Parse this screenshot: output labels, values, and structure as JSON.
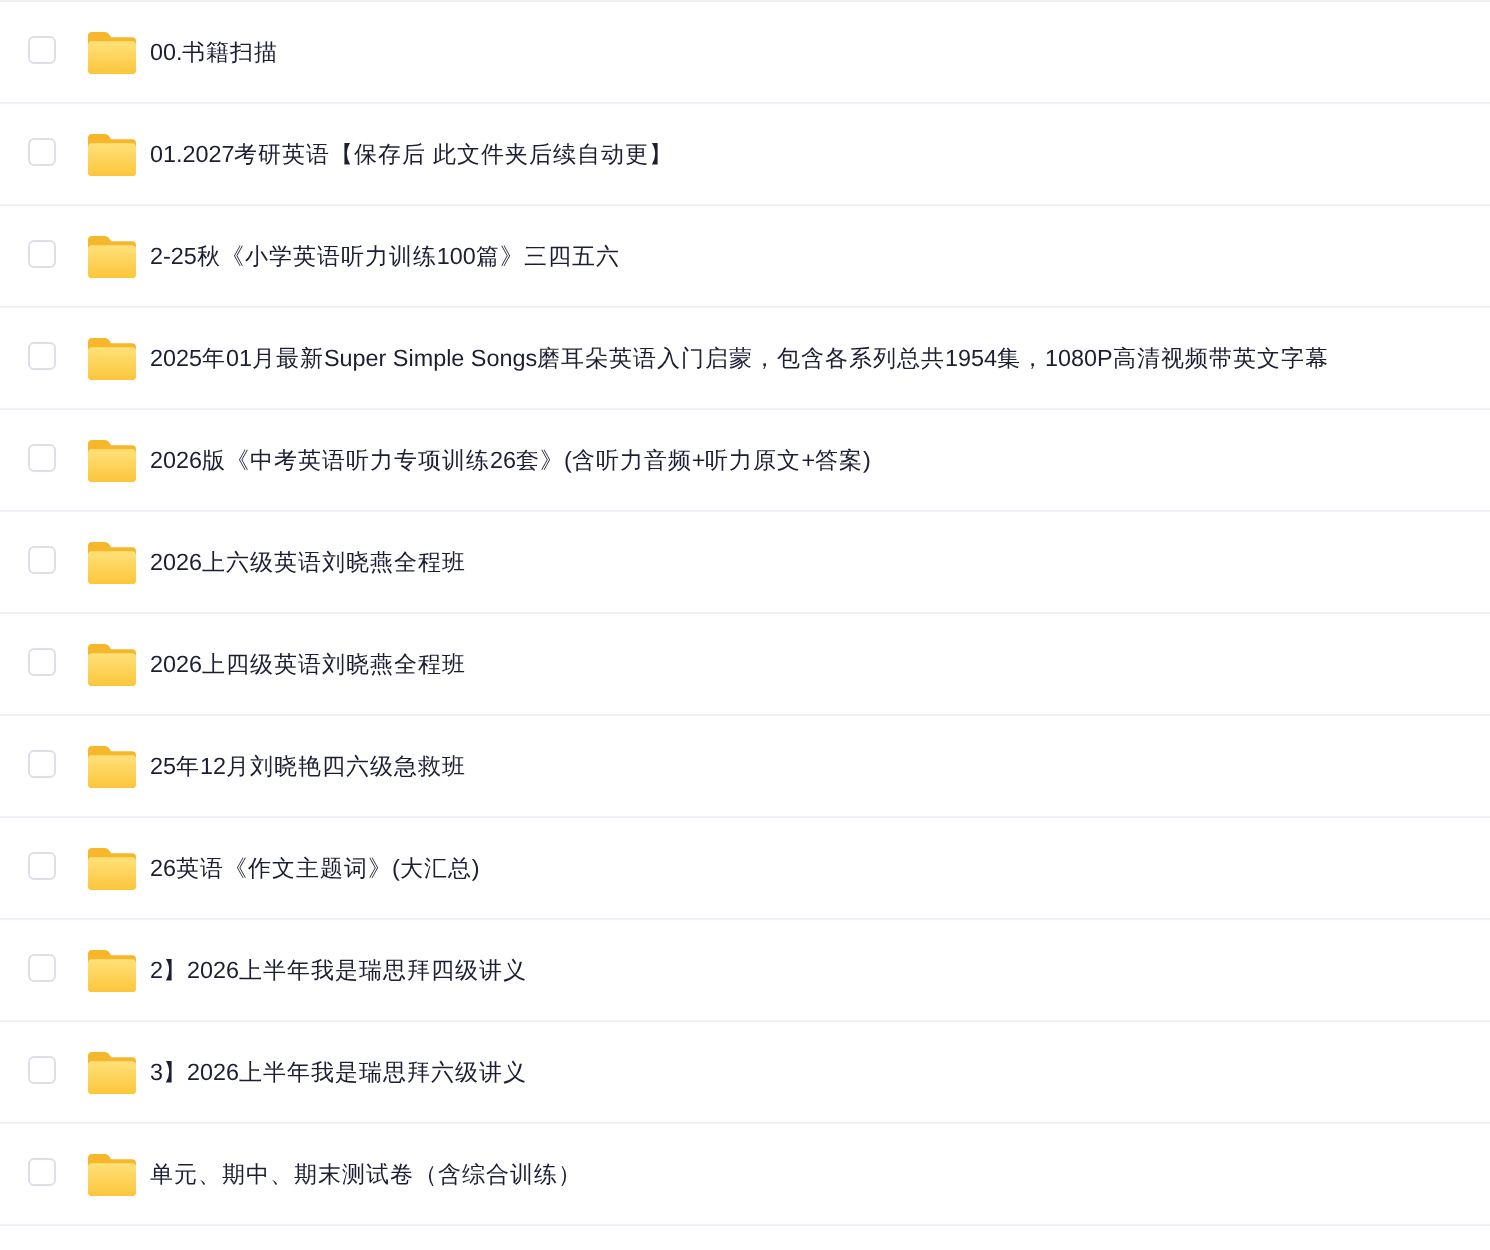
{
  "files": [
    {
      "name": "00.书籍扫描",
      "checked": false
    },
    {
      "name": "01.2027考研英语【保存后 此文件夹后续自动更】",
      "checked": false
    },
    {
      "name": "2-25秋《小学英语听力训练100篇》三四五六",
      "checked": false
    },
    {
      "name": "2025年01月最新Super Simple Songs磨耳朵英语入门启蒙，包含各系列总共1954集，1080P高清视频带英文字幕",
      "checked": false
    },
    {
      "name": "2026版《中考英语听力专项训练26套》(含听力音频+听力原文+答案)",
      "checked": false
    },
    {
      "name": "2026上六级英语刘晓燕全程班",
      "checked": false
    },
    {
      "name": "2026上四级英语刘晓燕全程班",
      "checked": false
    },
    {
      "name": "25年12月刘晓艳四六级急救班",
      "checked": false
    },
    {
      "name": "26英语《作文主题词》(大汇总)",
      "checked": false
    },
    {
      "name": "2】2026上半年我是瑞思拜四级讲义",
      "checked": false
    },
    {
      "name": "3】2026上半年我是瑞思拜六级讲义",
      "checked": false
    },
    {
      "name": "单元、期中、期末测试卷（含综合训练）",
      "checked": false
    }
  ]
}
